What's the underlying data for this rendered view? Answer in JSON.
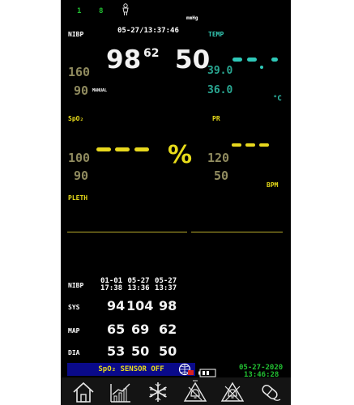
{
  "top": {
    "num1": "1",
    "num2": "8"
  },
  "nibp": {
    "label": "NIBP",
    "time": "05-27/13:37:46",
    "unit": "mmHg",
    "sys": "98",
    "mean": "62",
    "dia": "50",
    "high_limit": "160",
    "low_limit": "90",
    "mode": "MANUAL"
  },
  "temp": {
    "label": "TEMP",
    "high_limit": "39.0",
    "low_limit": "36.0",
    "unit": "°C"
  },
  "spo2": {
    "label": "SpO₂",
    "high_limit": "100",
    "low_limit": "90",
    "unit": "%"
  },
  "pr": {
    "label": "PR",
    "high_limit": "120",
    "low_limit": "50",
    "unit": "BPM"
  },
  "pleth": {
    "label": "PLETH"
  },
  "history": {
    "label": "NIBP",
    "times": [
      "01-01\n17:38",
      "05-27\n13:36",
      "05-27\n13:37"
    ],
    "time_row1": "01-01 05-27 05-27",
    "time_row2": "17:38 13:36 13:37",
    "rows": [
      {
        "label": "SYS",
        "values": [
          "94",
          "104",
          "98"
        ]
      },
      {
        "label": "MAP",
        "values": [
          "65",
          "69",
          "62"
        ]
      },
      {
        "label": "DIA",
        "values": [
          "53",
          "50",
          "50"
        ]
      }
    ]
  },
  "status": {
    "message": "SpO₂ SENSOR OFF"
  },
  "clock": {
    "date": "05-27-2020",
    "time": "13:46:28"
  },
  "toolbar": {
    "icons": [
      "home-icon",
      "trend-icon",
      "freeze-icon",
      "alarm-silence-icon",
      "alarm-off-icon",
      "pill-icon"
    ]
  },
  "colors": {
    "background": "#000000",
    "numeric_white": "#f2f2f2",
    "label_yellow": "#e8dc1a",
    "temp_cyan": "#33c9b4",
    "status_blue": "#0a0a8a"
  }
}
